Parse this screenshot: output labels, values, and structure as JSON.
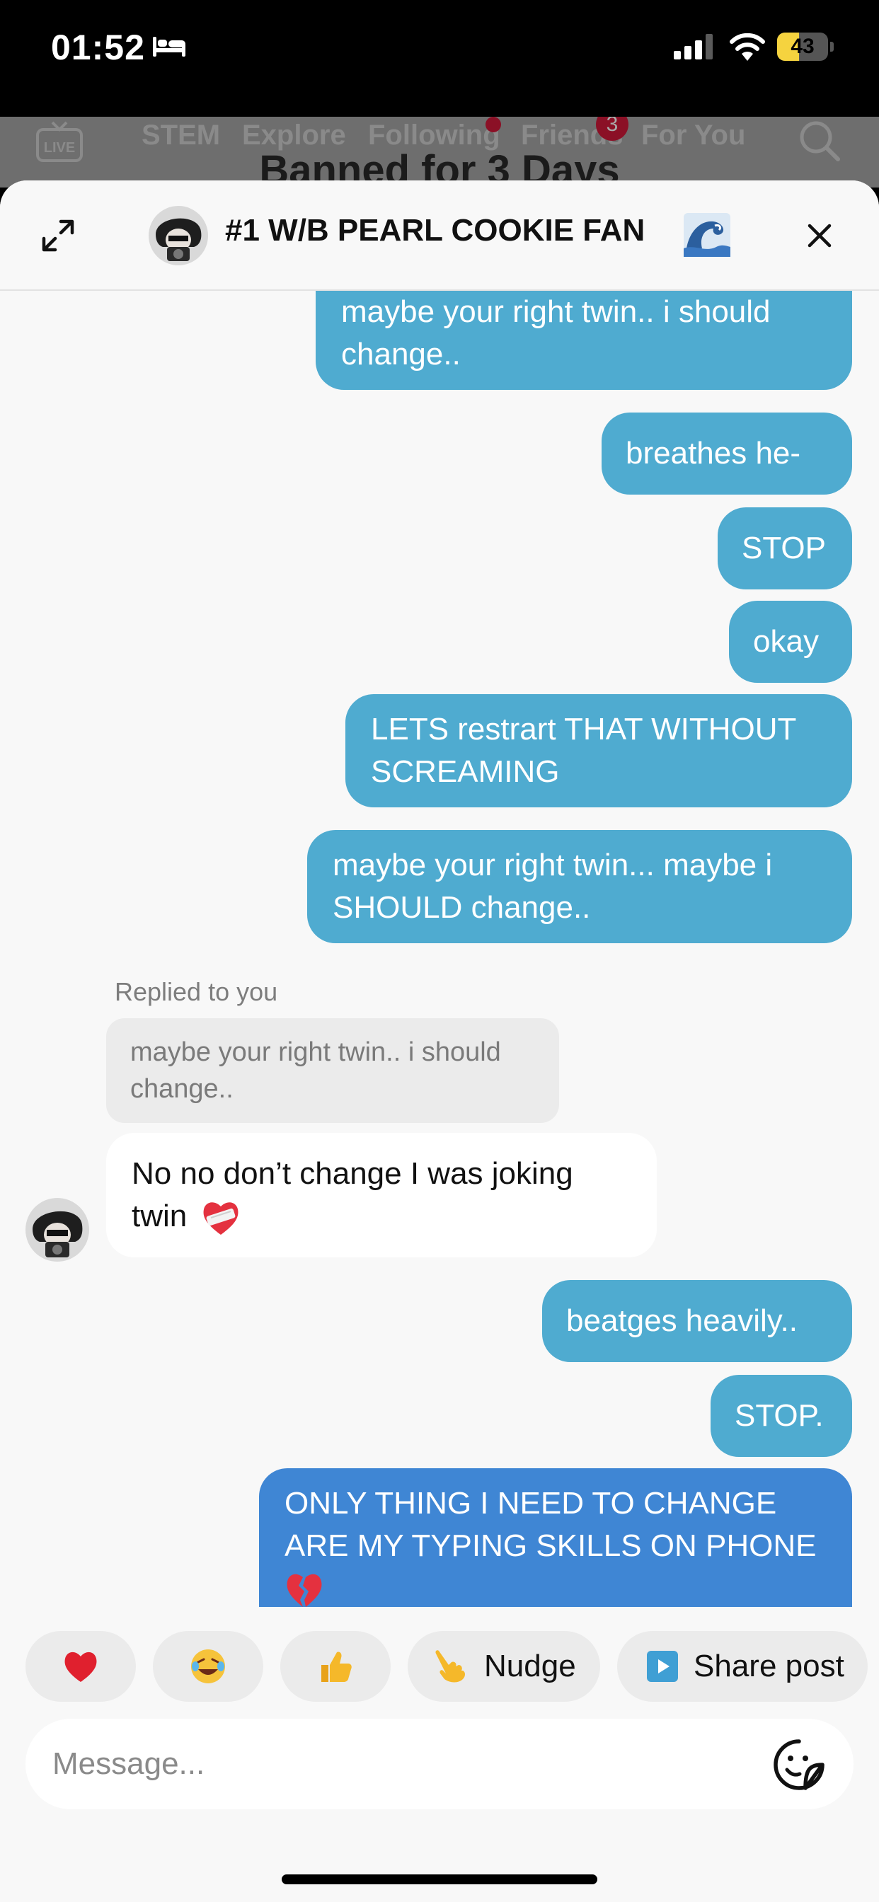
{
  "status_bar": {
    "time": "01:52",
    "battery_level": "43",
    "icons": [
      "bed-icon",
      "signal-icon",
      "wifi-icon",
      "battery-icon"
    ]
  },
  "background_feed": {
    "nav_tabs": [
      "STEM",
      "Explore",
      "Following",
      "Friends",
      "For You"
    ],
    "friends_badge": "3",
    "video_title": "Banned for 3 Days"
  },
  "chat": {
    "title": "#1 W/B PEARL COOKIE FAN",
    "title_emoji": "wave-emoji",
    "messages": {
      "m1": "maybe your right twin.. i should change..",
      "m2": "breathes he-",
      "m3": "STOP",
      "m4": "okay",
      "m5": "LETS restrart THAT WITHOUT SCREAMING",
      "m6": "maybe your right twin... maybe i SHOULD change..",
      "reply_label": "Replied to you",
      "quoted": "maybe your right twin.. i should change..",
      "m7": "No no don’t change I was joking twin",
      "m8": "beatges heavily..",
      "m9": "STOP.",
      "m10": "ONLY THING I NEED TO CHANGE ARE MY TYPING SKILLS ON PHONE"
    },
    "colors": {
      "outgoing_bubble": "#4fabd0",
      "latest_bubble": "#3f86d4",
      "incoming_bubble": "#ffffff"
    }
  },
  "quick_reactions": {
    "heart": "heart-emoji",
    "laugh": "laughing-emoji",
    "thumbs": "thumbs-up-emoji",
    "nudge": "Nudge",
    "share": "Share post"
  },
  "composer": {
    "placeholder": "Message..."
  }
}
